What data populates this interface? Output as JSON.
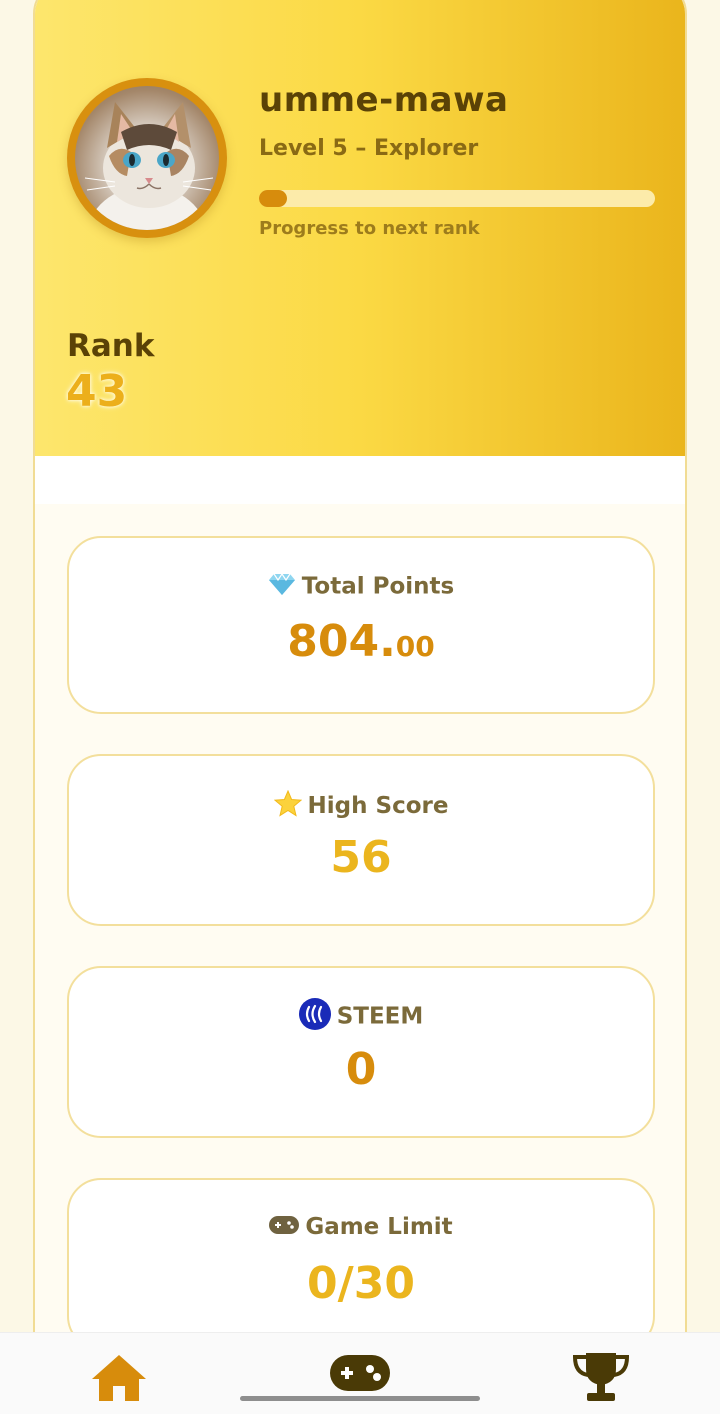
{
  "profile": {
    "username": "umme-mawa",
    "level_text": "Level 5 – Explorer",
    "progress_fraction": 0.07,
    "progress_caption": "Progress to next rank",
    "rank_label": "Rank",
    "rank_value": "43"
  },
  "stats": [
    {
      "icon": "gem-icon",
      "title": "Total Points",
      "value_int": "804.",
      "value_dec": "00",
      "color": "#d78c0c"
    },
    {
      "icon": "star-icon",
      "title": "High Score",
      "value": "56",
      "color": "#ebb51e"
    },
    {
      "icon": "steem-icon",
      "title": "STEEM",
      "value": "0",
      "color": "#d78c0c"
    },
    {
      "icon": "gamepad-icon",
      "title": "Game Limit",
      "value": "0/30",
      "color": "#ebb51e"
    }
  ],
  "nav": [
    {
      "icon": "home-icon",
      "color": "#d78c0c"
    },
    {
      "icon": "gamepad-icon",
      "color": "#4a3a06"
    },
    {
      "icon": "trophy-icon",
      "color": "#4a3a06"
    }
  ],
  "colors": {
    "accent": "#d78c0c",
    "header_gradient_start": "#fde66d",
    "header_gradient_end": "#eab51c",
    "text_dark": "#5a4206"
  }
}
